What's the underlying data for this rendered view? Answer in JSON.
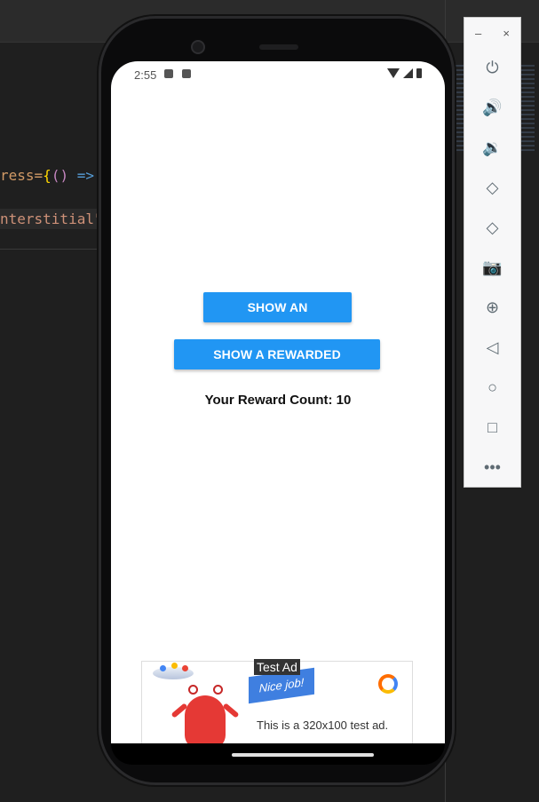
{
  "editor": {
    "code_line_1_start": "ress=",
    "code_line_1_brace": "{",
    "code_line_1_paren": "()",
    "code_line_1_arrow": " =>",
    "code_line_2": "nterstitial\""
  },
  "status_bar": {
    "time": "2:55"
  },
  "app": {
    "button_interstitial": "SHOW AN INTERSTITIAL",
    "button_rewarded": "SHOW A REWARDED INTERSTITIAL",
    "reward_count": "Your Reward Count: 10"
  },
  "ad": {
    "label": "Test Ad",
    "banner_text": "Nice job!",
    "body_text": "This is a 320x100 test ad."
  },
  "emulator_panel": {
    "minimize": "–",
    "close": "×",
    "controls": [
      {
        "name": "power-icon",
        "glyph": "⏻"
      },
      {
        "name": "volume-up-icon",
        "glyph": "🔊"
      },
      {
        "name": "volume-down-icon",
        "glyph": "🔉"
      },
      {
        "name": "rotate-left-icon",
        "glyph": "◇"
      },
      {
        "name": "rotate-right-icon",
        "glyph": "◇"
      },
      {
        "name": "camera-icon",
        "glyph": "📷"
      },
      {
        "name": "zoom-icon",
        "glyph": "⊕"
      },
      {
        "name": "back-icon",
        "glyph": "◁"
      },
      {
        "name": "home-icon",
        "glyph": "○"
      },
      {
        "name": "overview-icon",
        "glyph": "□"
      },
      {
        "name": "more-icon",
        "glyph": "•••"
      }
    ]
  },
  "colors": {
    "button": "#2196f3",
    "editor_bg": "#1f1f1f"
  }
}
